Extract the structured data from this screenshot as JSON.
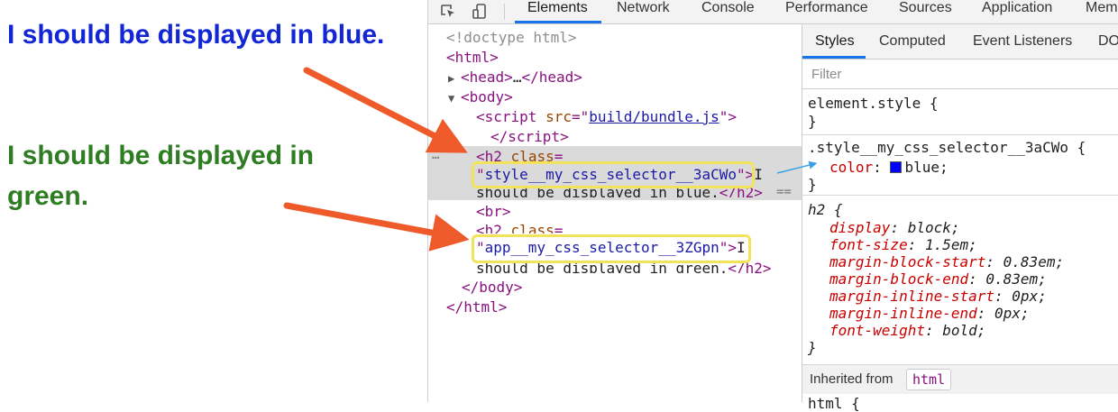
{
  "preview": {
    "blue_heading": "I should be displayed in blue.",
    "green_heading": "I should be displayed in green.",
    "colors": {
      "blue": "#1226d6",
      "green": "#2f7d23",
      "arrow": "#ee5a2a",
      "highlight": "#f3e35a"
    }
  },
  "devtools": {
    "toolbar_icons": [
      "inspect-element-icon",
      "device-toolbar-icon"
    ],
    "tabs": [
      "Elements",
      "Network",
      "Console",
      "Performance",
      "Sources",
      "Application",
      "Mem"
    ],
    "active_tab": "Elements",
    "dom": {
      "doctype": "<!doctype html>",
      "html_open": "html",
      "head_collapsed": "…",
      "head": "head",
      "body": "body",
      "script_tag": "script",
      "script_attr": "src",
      "script_src": "build/bundle.js",
      "h2": "h2",
      "class_attr": "class",
      "class_blue": "style__my_css_selector__3aCWo",
      "text_blue_start": "I",
      "text_blue_rest": "should be displayed in blue.",
      "equals_marker": "==",
      "ellipsis_marker": "…",
      "br": "br",
      "class_green": "app__my_css_selector__3ZGpn",
      "text_green_start": "I",
      "text_green_rest": "should be displayed in green."
    },
    "styles": {
      "subtabs": [
        "Styles",
        "Computed",
        "Event Listeners",
        "DO"
      ],
      "filter_placeholder": "Filter",
      "element_style": "element.style",
      "rule1_selector": ".style__my_css_selector__3aCWo",
      "rule1_prop": "color",
      "rule1_value": "blue",
      "rule2_selector": "h2",
      "rule2_decls": [
        {
          "prop": "display",
          "value": "block"
        },
        {
          "prop": "font-size",
          "value": "1.5em"
        },
        {
          "prop": "margin-block-start",
          "value": "0.83em"
        },
        {
          "prop": "margin-block-end",
          "value": "0.83em"
        },
        {
          "prop": "margin-inline-start",
          "value": "0px"
        },
        {
          "prop": "margin-inline-end",
          "value": "0px"
        },
        {
          "prop": "font-weight",
          "value": "bold"
        }
      ],
      "inherited_label": "Inherited from",
      "inherited_tag": "html",
      "cut_line": "html {"
    }
  }
}
